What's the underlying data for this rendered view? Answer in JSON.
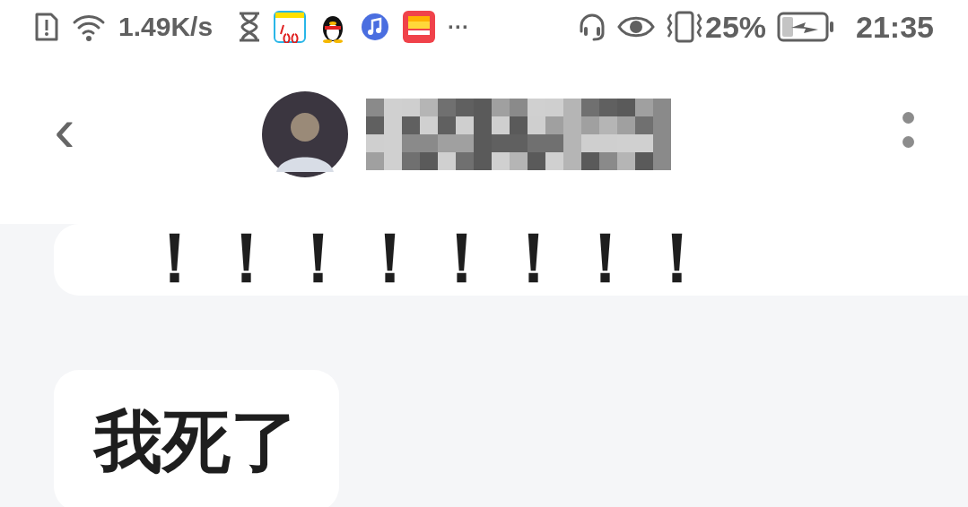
{
  "status_bar": {
    "network_speed": "1.49K/s",
    "more_indicator": "···",
    "battery": "25%",
    "time": "21:35"
  },
  "header": {
    "back": "‹"
  },
  "messages": [
    {
      "kind": "text",
      "text": "！！！！！！！！"
    },
    {
      "kind": "text",
      "text": "我死了"
    }
  ]
}
